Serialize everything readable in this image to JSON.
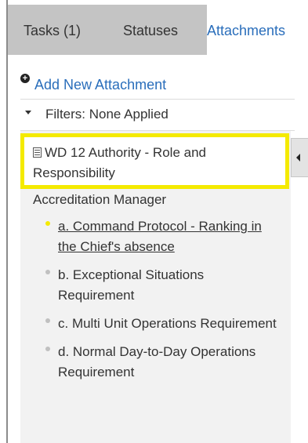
{
  "tabs": [
    {
      "label": "Tasks (1)"
    },
    {
      "label": "Statuses"
    },
    {
      "label": "Attachments"
    }
  ],
  "add_attachment": {
    "label": "Add New Attachment",
    "icon": "plus-circle-icon"
  },
  "filters": {
    "label": "Filters: None Applied",
    "icon": "caret-down-icon"
  },
  "document": {
    "title": "WD 12 Authority - Role and Responsibility",
    "icon": "document-icon"
  },
  "section": {
    "label": "Accreditation Manager"
  },
  "items": [
    {
      "label": "a. Command Protocol - Ranking in the Chief's absence",
      "active": true
    },
    {
      "label": "b. Exceptional Situations Requirement",
      "active": false
    },
    {
      "label": "c. Multi Unit Operations Requirement",
      "active": false
    },
    {
      "label": "d. Normal Day-to-Day Operations Requirement",
      "active": false
    }
  ],
  "colors": {
    "link": "#2a6ebb",
    "tab_bar": "#c4c4c4",
    "highlight": "#f4ea00",
    "content_bg": "#f2f2f2"
  }
}
